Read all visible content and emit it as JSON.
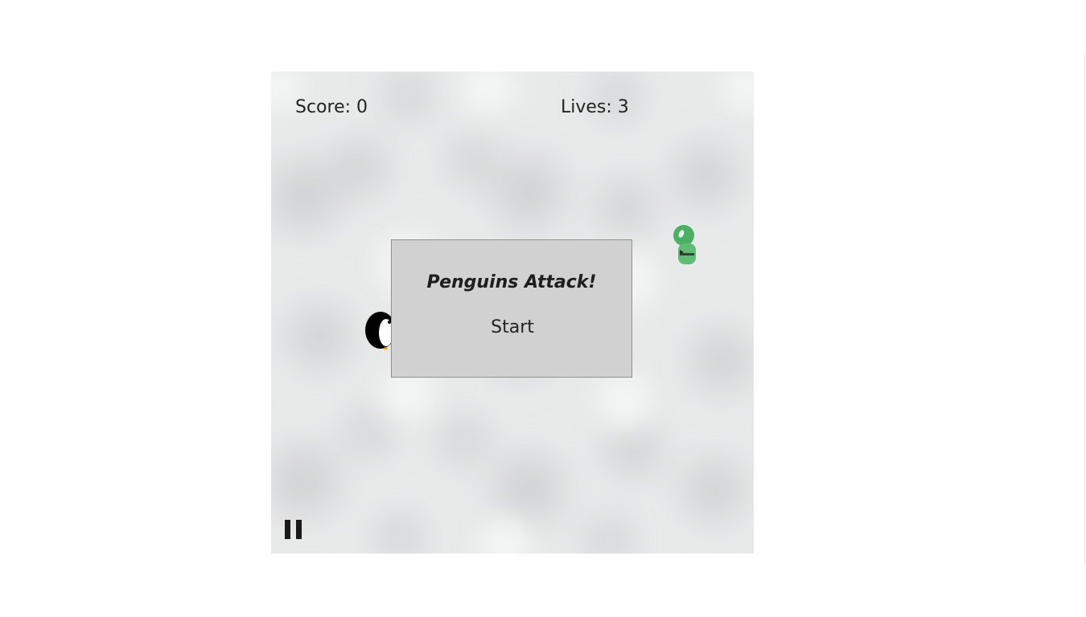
{
  "hud": {
    "score_text": "Score: 0",
    "lives_text": "Lives: 3"
  },
  "menu": {
    "title": "Penguins Attack!",
    "start_label": "Start"
  },
  "icons": {
    "pause": "pause-icon",
    "player": "penguin-icon",
    "enemy": "green-creature-icon"
  },
  "colors": {
    "dialog_bg": "#d1d1d1",
    "dialog_border": "#8f8f8f",
    "text": "#222222",
    "ice_bg": "#e9ebeb",
    "enemy_green": "#4caf64",
    "penguin_beak": "#f5a623"
  }
}
